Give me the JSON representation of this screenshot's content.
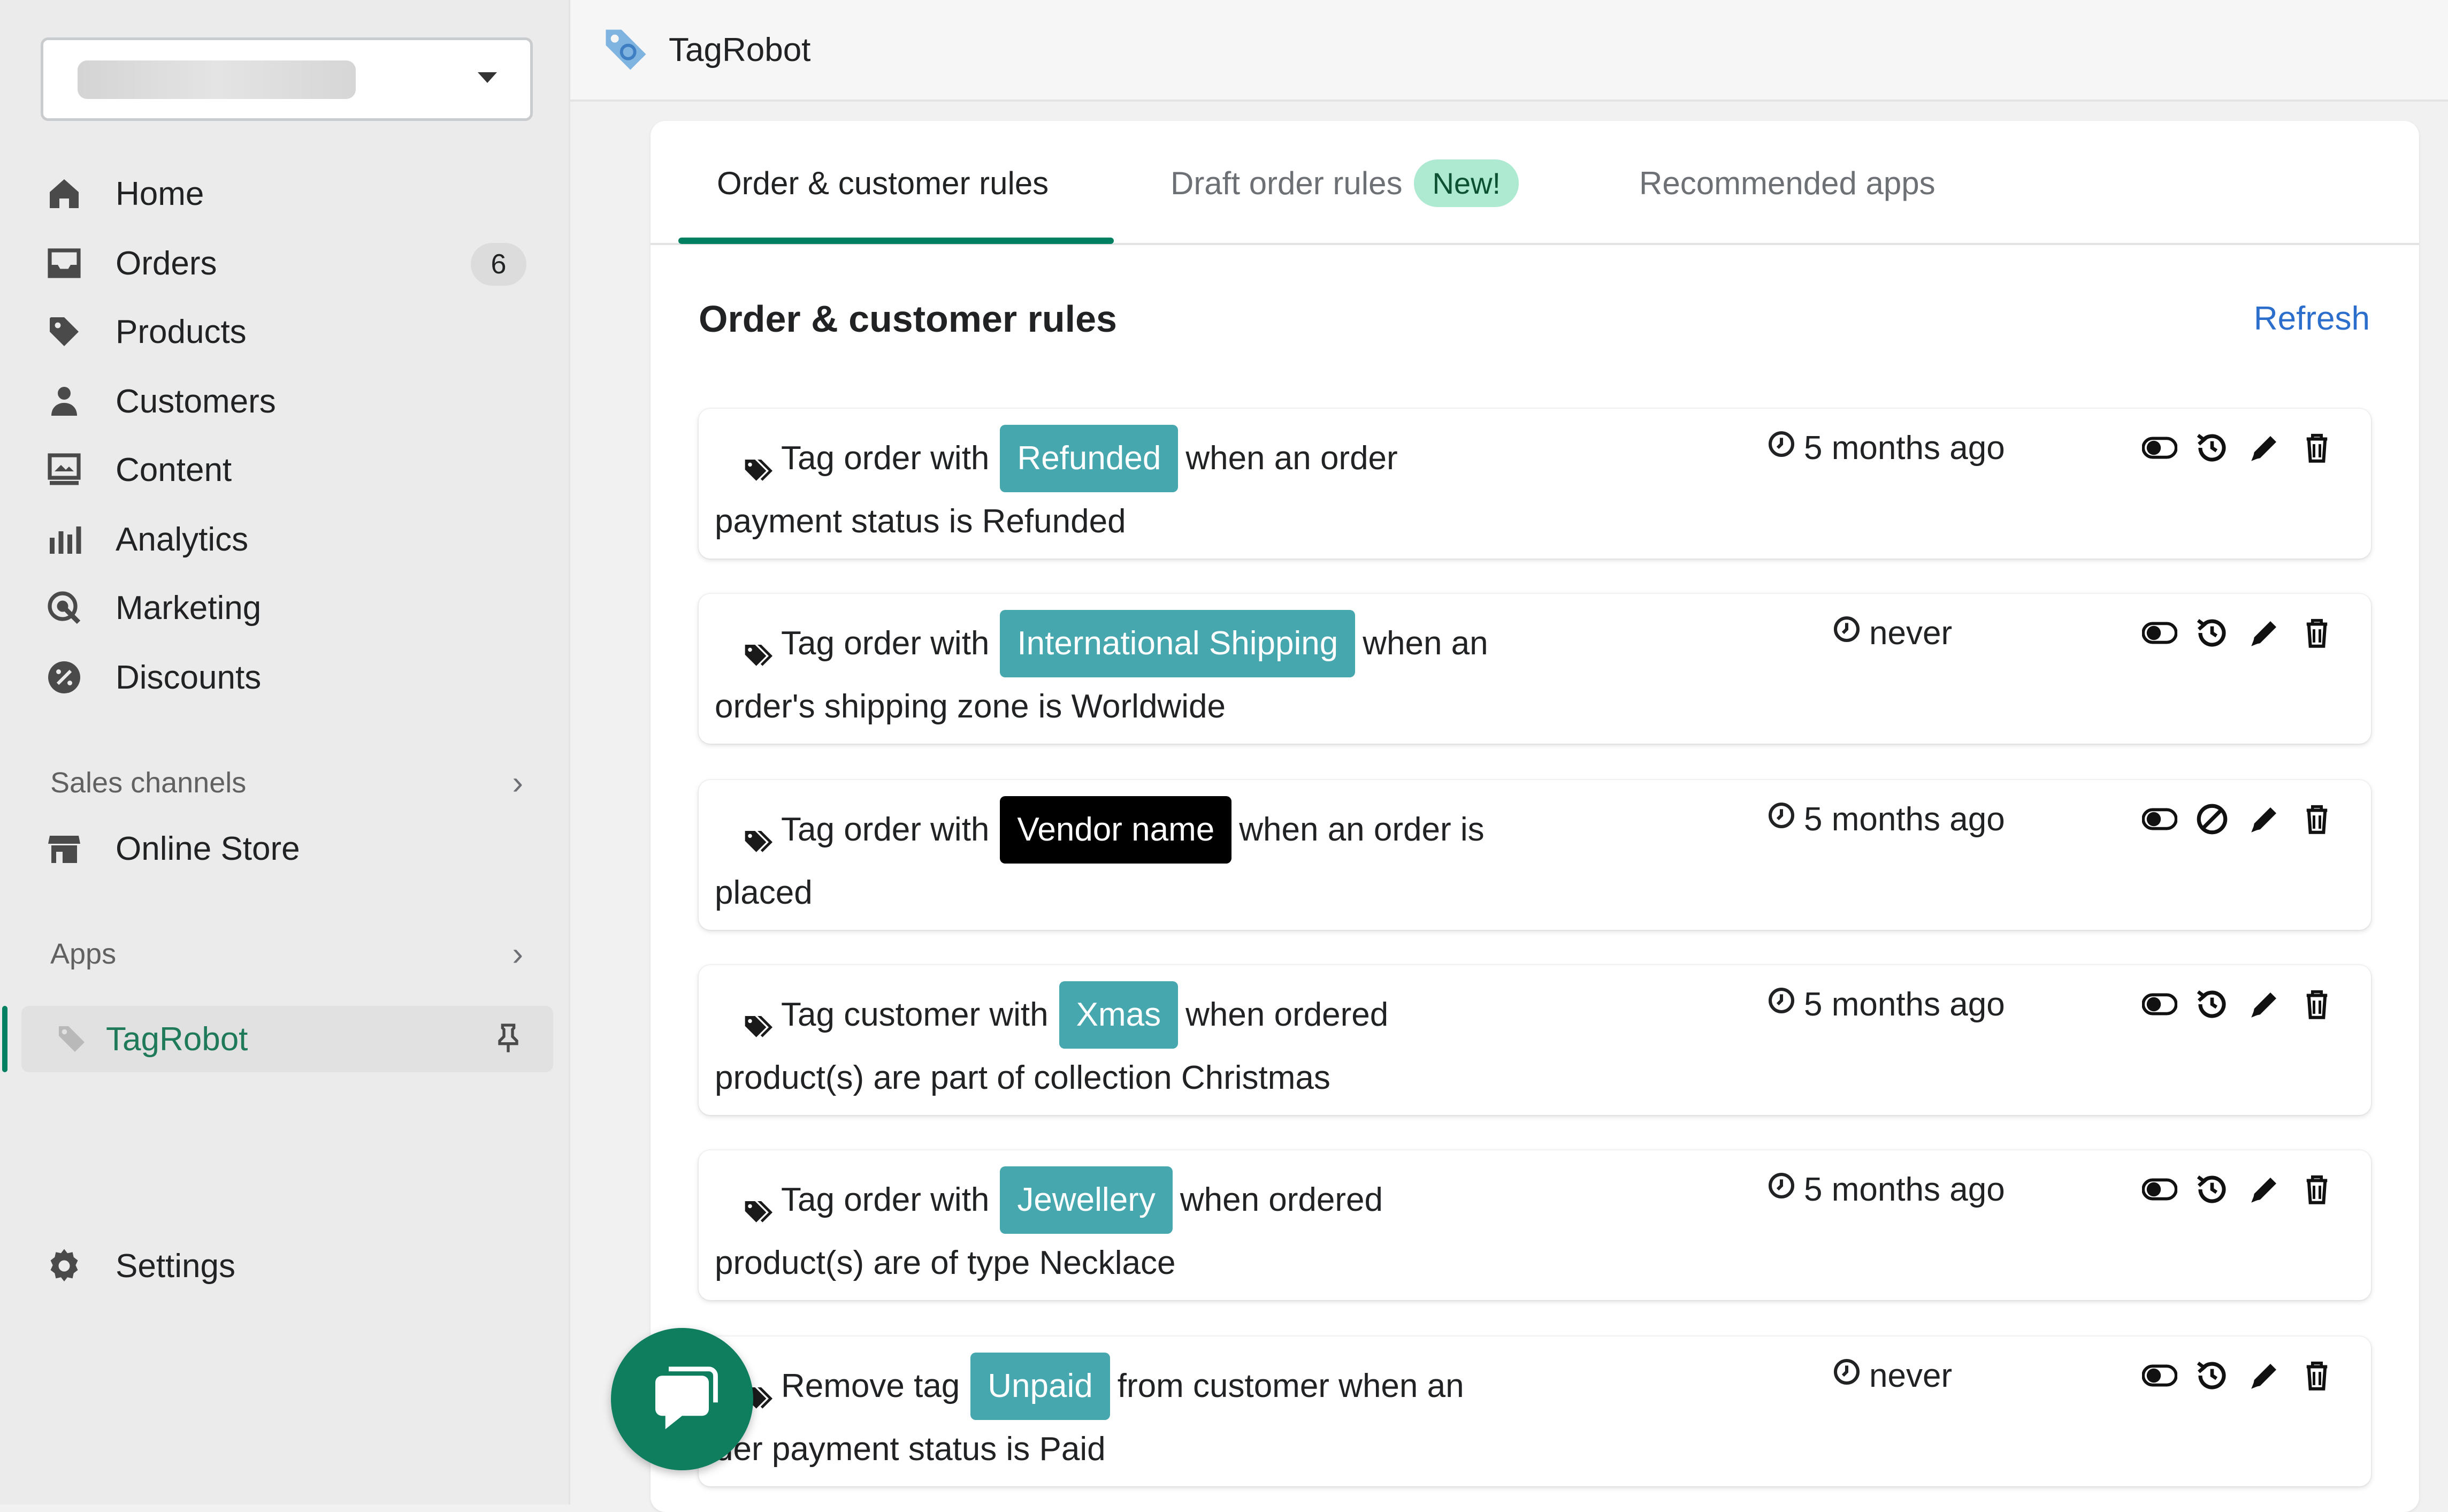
{
  "app": {
    "title": "TagRobot"
  },
  "sidebar": {
    "store_name": "",
    "nav": [
      {
        "label": "Home",
        "icon": "home-icon"
      },
      {
        "label": "Orders",
        "icon": "orders-icon",
        "badge": "6"
      },
      {
        "label": "Products",
        "icon": "tag-icon"
      },
      {
        "label": "Customers",
        "icon": "person-icon"
      },
      {
        "label": "Content",
        "icon": "content-icon"
      },
      {
        "label": "Analytics",
        "icon": "bar-chart-icon"
      },
      {
        "label": "Marketing",
        "icon": "marketing-icon"
      },
      {
        "label": "Discounts",
        "icon": "discount-icon"
      }
    ],
    "sales_channels": {
      "label": "Sales channels",
      "items": [
        {
          "label": "Online Store",
          "icon": "store-icon"
        }
      ]
    },
    "apps": {
      "label": "Apps",
      "items": [
        {
          "label": "TagRobot",
          "icon": "tagrobot-logo-icon"
        }
      ]
    },
    "settings": {
      "label": "Settings",
      "icon": "gear-icon"
    }
  },
  "tabs": [
    {
      "label": "Order & customer rules",
      "active": true
    },
    {
      "label": "Draft order rules",
      "badge": "New!",
      "active": false
    },
    {
      "label": "Recommended apps",
      "active": false
    }
  ],
  "main": {
    "title": "Order & customer rules",
    "refresh_label": "Refresh",
    "rules": [
      {
        "prefix": "Tag order with",
        "tag": "Refunded",
        "tag_style": "teal",
        "line1_rest": "when an order",
        "line2": "payment status is Refunded",
        "time": "5 months ago",
        "status_icon": "history-icon"
      },
      {
        "prefix": "Tag order with",
        "tag": "International Shipping",
        "tag_style": "teal",
        "line1_rest": "when an",
        "line2": "order's shipping zone is Worldwide",
        "time": "never",
        "status_icon": "history-icon"
      },
      {
        "prefix": "Tag order with",
        "tag": "Vendor name",
        "tag_style": "dark",
        "line1_rest": "when an order is",
        "line2": "placed",
        "time": "5 months ago",
        "status_icon": "no-history-icon"
      },
      {
        "prefix": "Tag customer with",
        "tag": "Xmas",
        "tag_style": "teal",
        "line1_rest": "when ordered",
        "line2": "product(s) are part of collection Christmas",
        "time": "5 months ago",
        "status_icon": "history-icon"
      },
      {
        "prefix": "Tag order with",
        "tag": "Jewellery",
        "tag_style": "teal",
        "line1_rest": "when ordered",
        "line2": "product(s) are of type Necklace",
        "time": "5 months ago",
        "status_icon": "history-icon"
      },
      {
        "prefix": "Remove tag",
        "tag": "Unpaid",
        "tag_style": "teal",
        "line1_rest": "from customer when an",
        "line2": "der payment status is Paid",
        "time": "never",
        "status_icon": "history-icon"
      }
    ]
  },
  "colors": {
    "accent": "#008060",
    "tag": "#47a7ae",
    "link": "#2c6ecb",
    "new_badge": "#aee9d1"
  }
}
